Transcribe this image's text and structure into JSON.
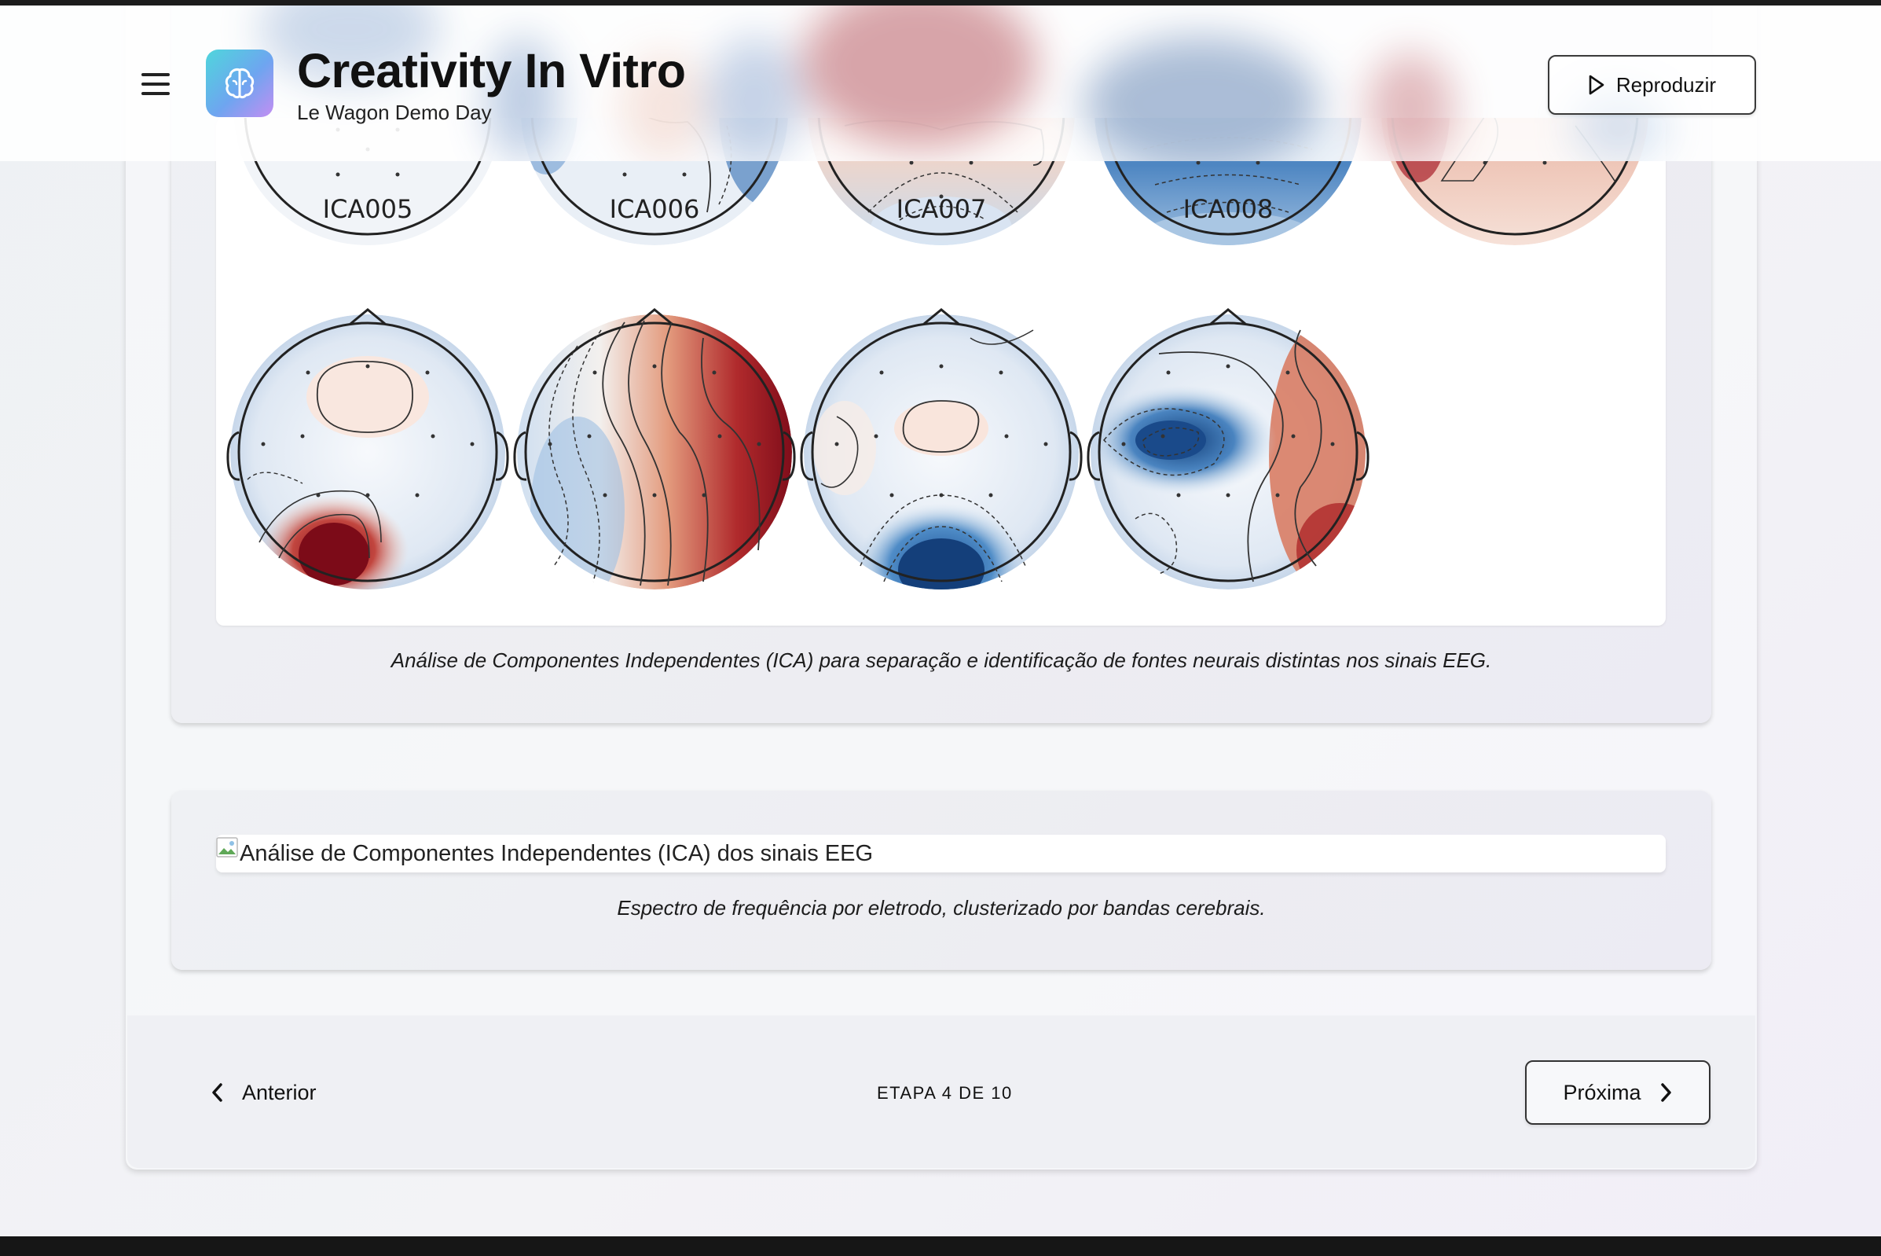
{
  "header": {
    "title": "Creativity In Vitro",
    "subtitle": "Le Wagon Demo Day",
    "play_label": "Reproduzir",
    "menu_icon": "hamburger-menu-icon",
    "logo_icon": "brain-icon"
  },
  "ica_figure": {
    "component_labels": [
      "ICA005",
      "ICA006",
      "ICA007",
      "ICA008"
    ],
    "caption": "Análise de Componentes Independentes (ICA) para separação e identificação de fontes neurais distintas nos sinais EEG."
  },
  "spectrum_figure": {
    "image_alt": "Análise de Componentes Independentes (ICA) dos sinais EEG",
    "caption": "Espectro de frequência por eletrodo, clusterizado por bandas cerebrais."
  },
  "footer": {
    "prev_label": "Anterior",
    "step_text": "ETAPA 4 DE 10",
    "next_label": "Próxima"
  },
  "colors": {
    "logo_gradient_start": "#4fd6dc",
    "logo_gradient_end": "#c38ef2",
    "topomap_red": "#8b0f1a",
    "topomap_blue": "#1d4f8f"
  }
}
